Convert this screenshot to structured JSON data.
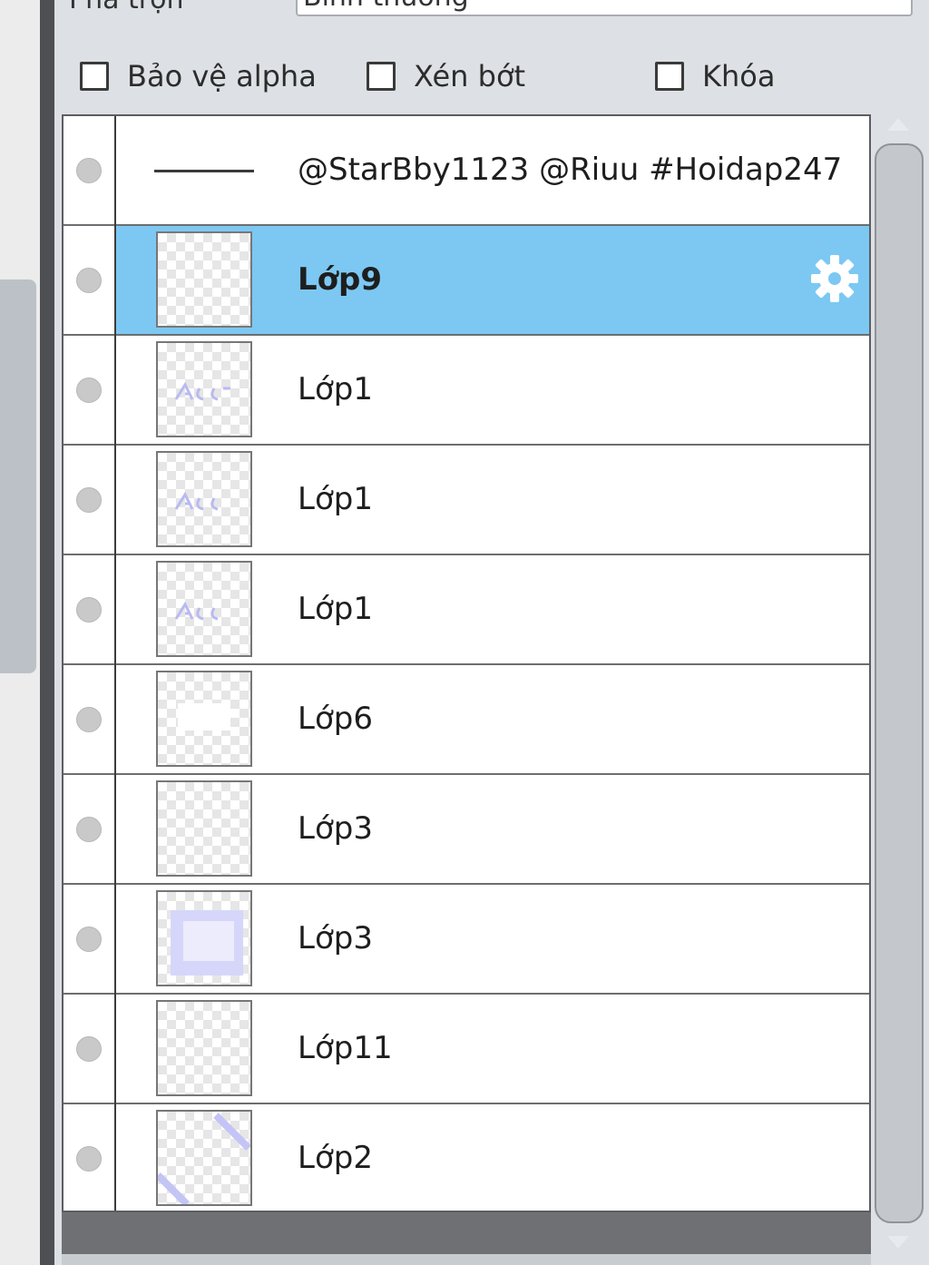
{
  "blend": {
    "label": "Pha trộn",
    "value": "Bình thường"
  },
  "options": {
    "alpha_protect": "Bảo vệ alpha",
    "clipping": "Xén bớt",
    "lock": "Khóa"
  },
  "layers": [
    {
      "name": "@StarBby1123 @Riuu #Hoidap247",
      "type": "folder"
    },
    {
      "name": "Lớp9",
      "selected": true
    },
    {
      "name": "Lớp1"
    },
    {
      "name": "Lớp1"
    },
    {
      "name": "Lớp1"
    },
    {
      "name": "Lớp6"
    },
    {
      "name": "Lớp3"
    },
    {
      "name": "Lớp3"
    },
    {
      "name": "Lớp11"
    },
    {
      "name": "Lớp2"
    }
  ],
  "colors": {
    "selection": "#7cc8f3",
    "divider": "#4d4f52"
  },
  "icons": {
    "settings": "gear-icon",
    "visibility": "visibility-dot-icon"
  }
}
